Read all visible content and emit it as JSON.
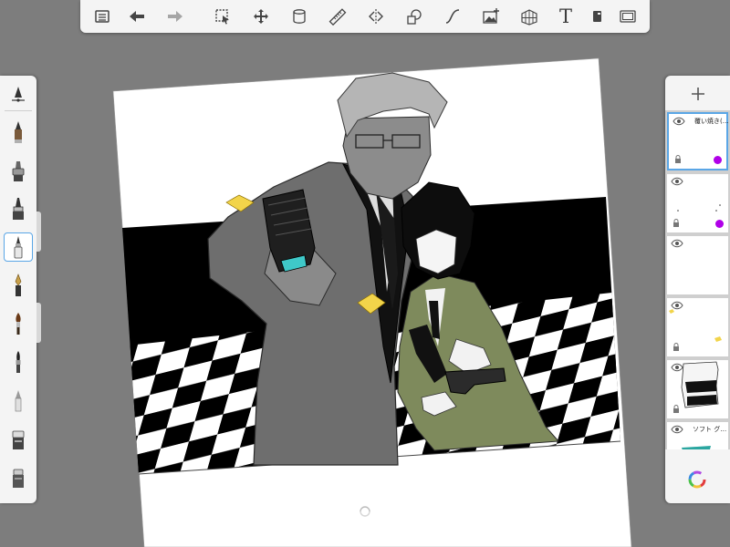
{
  "app": {
    "toolbar": {
      "tools": [
        "gallery",
        "undo",
        "redo",
        "selection",
        "transform",
        "fill",
        "ruler",
        "symmetry",
        "shapes",
        "stroke",
        "import-image",
        "perspective-grid",
        "text",
        "time-lapse",
        "fullscreen"
      ],
      "text_tool_label": "T"
    },
    "brushes": [
      "brush-options",
      "pencil",
      "hard-airbrush",
      "marker",
      "fineliner",
      "ink-pen",
      "paint-brush",
      "calligraphy-brush",
      "soft-pencil",
      "eraser",
      "blender"
    ],
    "selected_brush": "fineliner",
    "layers": [
      {
        "name": "覆い焼き(…",
        "visible": true,
        "selected": true,
        "dot_color": "#b000e8"
      },
      {
        "name": "",
        "visible": true,
        "selected": false,
        "dot_color": "#b000e8"
      },
      {
        "name": "",
        "visible": true,
        "selected": false,
        "dot_color": ""
      },
      {
        "name": "",
        "visible": true,
        "selected": false,
        "dot_color": ""
      },
      {
        "name": "",
        "visible": true,
        "selected": false,
        "dot_color": ""
      },
      {
        "name": "ソフト グ…",
        "visible": true,
        "selected": false,
        "dot_color": ""
      }
    ],
    "colors": {
      "accent": "#5aa6e6",
      "background": "#7d7d7d",
      "panel": "#f4f4f4",
      "coat_gray": "#6e6e6e",
      "olive_coat": "#7e8a5c",
      "badge_yellow": "#f2d44a",
      "teal": "#3fc8c8"
    }
  }
}
